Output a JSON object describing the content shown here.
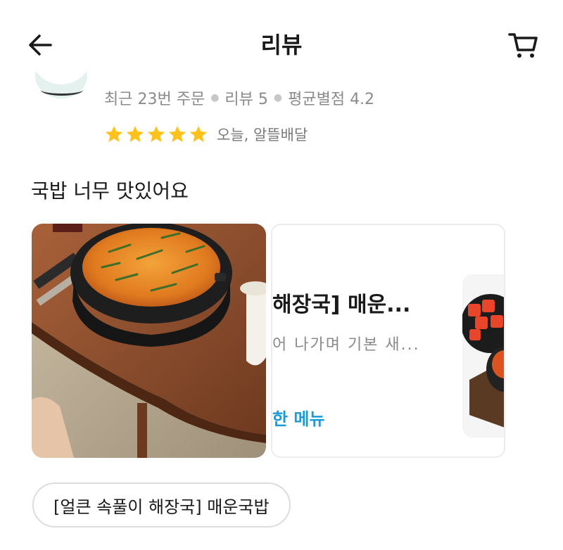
{
  "header": {
    "title": "리뷰",
    "back_icon": "back-arrow-icon",
    "cart_icon": "cart-icon"
  },
  "reviewer": {
    "recent_orders": "최근 23번 주문",
    "review_count": "리뷰 5",
    "avg_rating": "평균별점 4.2"
  },
  "review": {
    "rating": 5,
    "max_rating": 5,
    "date": "오늘, 알뜰배달",
    "text": "국밥 너무 맛있어요",
    "star_color": "#FFC21A"
  },
  "menu_card": {
    "title": "해장국] 매운...",
    "description": "어 나가며 기본 새...",
    "link": "한 메뉴",
    "link_color": "#1a9bd8"
  },
  "ordered_item": {
    "label": "[얼큰 속풀이 해장국] 매운국밥"
  }
}
